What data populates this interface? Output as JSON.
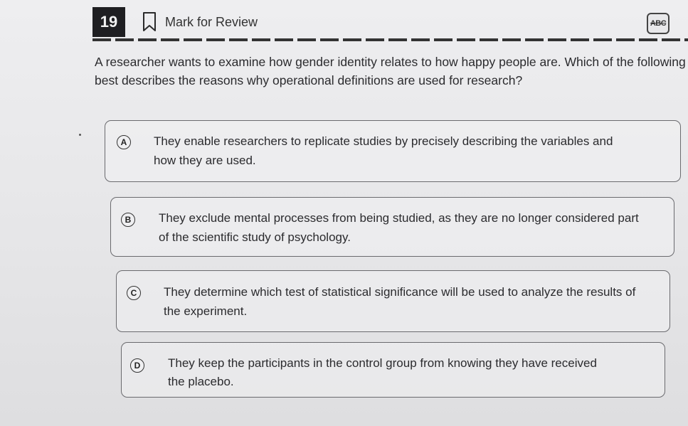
{
  "header": {
    "question_number": "19",
    "mark_for_review_label": "Mark for Review",
    "tool_label": "ABC",
    "mark_icon": "bookmark-icon"
  },
  "question": {
    "text": "A researcher wants to examine how gender identity relates to how happy people are. Which of the following best describes the reasons why operational definitions are used for research?"
  },
  "choices": [
    {
      "letter": "A",
      "text": "They enable researchers to replicate studies by precisely describing the variables and how they are used."
    },
    {
      "letter": "B",
      "text": "They exclude mental processes from being studied, as they are no longer considered part of the scientific study of psychology."
    },
    {
      "letter": "C",
      "text": "They determine which test of statistical significance will be used to analyze the results of the experiment."
    },
    {
      "letter": "D",
      "text": "They keep the participants in the control group from knowing they have received the placebo."
    }
  ]
}
